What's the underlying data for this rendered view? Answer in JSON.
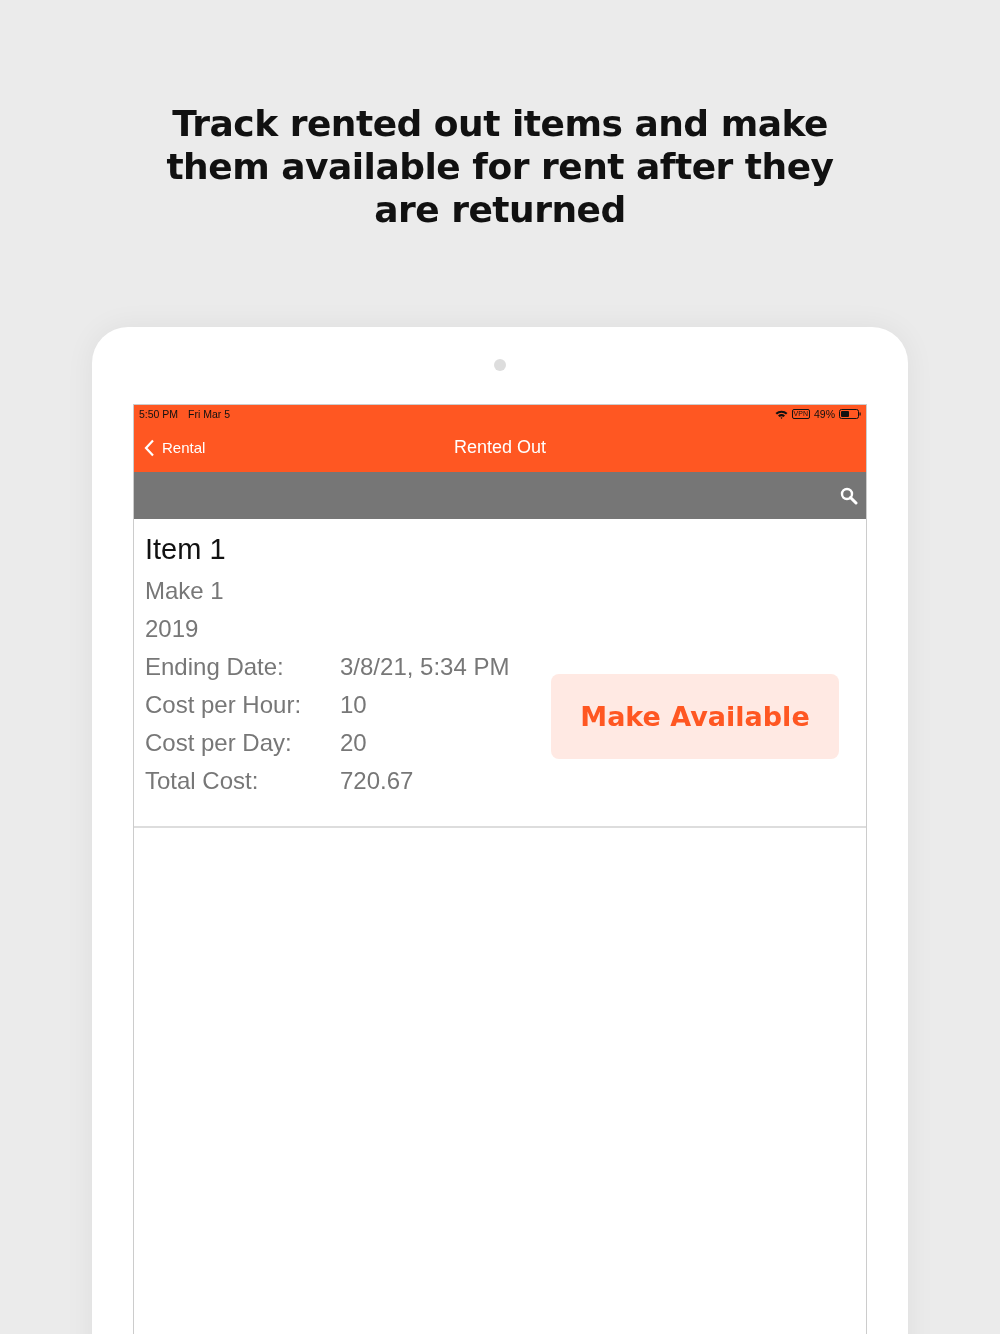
{
  "headline": "Track rented out items and make them available for rent after they are returned",
  "status_bar": {
    "time": "5:50 PM",
    "date": "Fri Mar 5",
    "vpn": "VPN",
    "battery": "49%"
  },
  "nav": {
    "back": "Rental",
    "title": "Rented Out"
  },
  "items": [
    {
      "name": "Item 1",
      "make": "Make 1",
      "year": "2019",
      "details": [
        {
          "label": "Ending Date:",
          "value": "3/8/21, 5:34 PM"
        },
        {
          "label": "Cost per Hour:",
          "value": "10"
        },
        {
          "label": "Cost per Day:",
          "value": "20"
        },
        {
          "label": "Total Cost:",
          "value": "720.67"
        }
      ],
      "action": "Make Available"
    }
  ]
}
